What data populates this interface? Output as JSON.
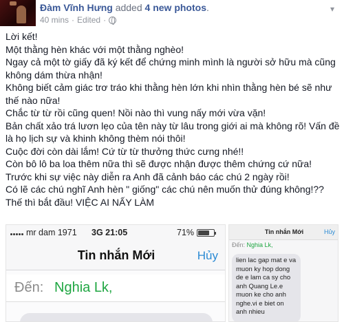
{
  "post": {
    "author": "Đàm Vĩnh Hưng",
    "action_prefix": "added",
    "action_strong": "4 new photos",
    "action_suffix": ".",
    "time": "40 mins",
    "separator": "·",
    "edited": "Edited",
    "separator2": "·",
    "privacy": "public",
    "paragraphs": [
      "Lời kết!",
      "Một thằng hèn khác với một thằng nghèo!",
      "Ngay cả một tờ giấy đã ký kết để chứng minh mình là người sở hữu mà cũng không dám thừa nhận!",
      "Không biết cảm giác trơ tráo khi thằng hèn lớn khi nhìn thằng hèn bé sẽ như thế nào nữa!",
      "Chắc từ từ rồi cũng quen! Nồi nào thì vung nấy mới vừa vặn!",
      "Bản chất xảo trá lươn lẹo của tên này từ lâu trong giới ai mà không rõ! Vấn đề là họ lịch sự và khinh không thèm nói thôi!",
      "Cuộc đời còn dài lắm! Cứ từ từ thưởng thức cưng nhé!!",
      "Còn bô lô ba loa thêm nữa thì sẽ được nhận được thêm chứng cứ nữa!",
      "Trước khi sự việc này diễn ra Anh đã cảnh báo các chú 2 ngày rồi!",
      "Có lẽ các chú nghĩ Anh hèn \" giống\" các chú nên muốn thử đúng không!??",
      "Thế thì bắt đầu! VIỆC AI NẤY LÀM"
    ]
  },
  "photo_main": {
    "carrier": "mr dam 1971",
    "network": "3G",
    "clock": "21:05",
    "battery": "71%",
    "battery_level": 0.71,
    "title": "Tin nhắn Mới",
    "cancel": "Hủy",
    "to_label": "Đến:",
    "to_value": "Nghia Lk,"
  },
  "photo_side": {
    "title": "Tin nhắn Mới",
    "cancel": "Hủy",
    "to_label": "Đến:",
    "to_value": "Nghia Lk,",
    "message": "lien lac gap mat e va muon ky hop dong de e lam ca sy cho anh Quang Le.e muon ke cho anh nghe.vi e biet on anh nhieu"
  }
}
